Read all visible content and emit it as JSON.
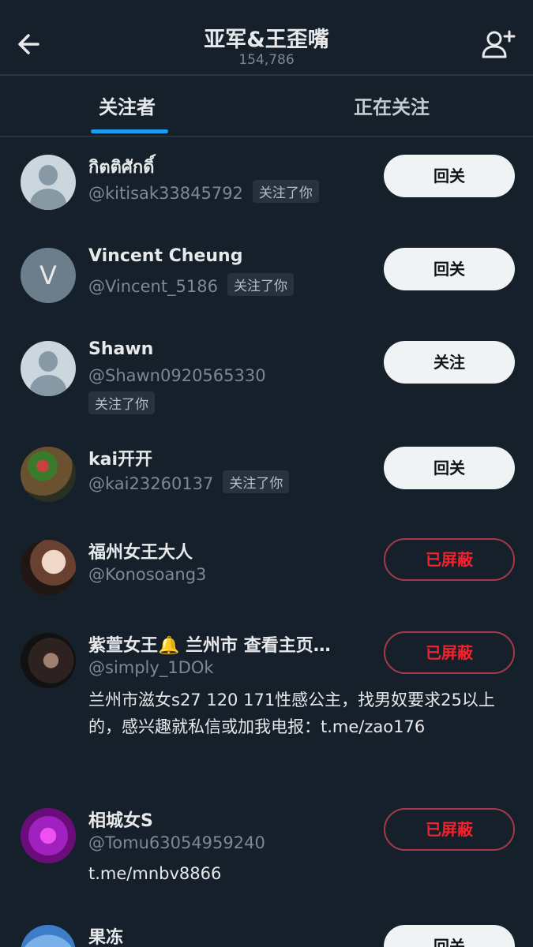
{
  "header": {
    "title": "亚军&王歪嘴",
    "subtitle": "154,786"
  },
  "tabs": {
    "followers": "关注者",
    "following": "正在关注"
  },
  "follows_you": "关注了你",
  "users": [
    {
      "name": "กิตติศักดิ์",
      "handle": "@kitisak33845792",
      "follows_you": true,
      "button": "回关",
      "avatar": "default"
    },
    {
      "name": "Vincent Cheung",
      "handle": "@Vincent_5186",
      "follows_you": true,
      "button": "回关",
      "avatar_letter": "V"
    },
    {
      "name": "Shawn",
      "handle": "@Shawn0920565330",
      "follows_you": true,
      "button": "关注",
      "avatar": "default"
    },
    {
      "name": "kai开开",
      "handle": "@kai23260137",
      "follows_you": true,
      "button": "回关",
      "avatar": "photo"
    },
    {
      "name": "福州女王大人",
      "handle": "@Konosoang3",
      "follows_you": false,
      "button": "已屏蔽",
      "avatar": "photo"
    },
    {
      "name": "紫萱女王🔔 兰州市 查看主页…",
      "handle": "@simply_1DOk",
      "follows_you": false,
      "button": "已屏蔽",
      "bio": "兰州市滋女s27 120 171性感公主，找男奴要求25以上的，感兴趣就私信或加我电报：t.me/zao176",
      "avatar": "photo"
    },
    {
      "name": "相城女S",
      "handle": "@Tomu63054959240",
      "follows_you": false,
      "button": "已屏蔽",
      "bio": "t.me/mnbv8866",
      "avatar": "photo"
    },
    {
      "name": "果冻",
      "handle": "",
      "follows_you": false,
      "button": "回关",
      "avatar": "photo"
    }
  ],
  "colors": {
    "background": "#15202b",
    "accent": "#1d9bf0",
    "blocked": "#f4212e"
  }
}
